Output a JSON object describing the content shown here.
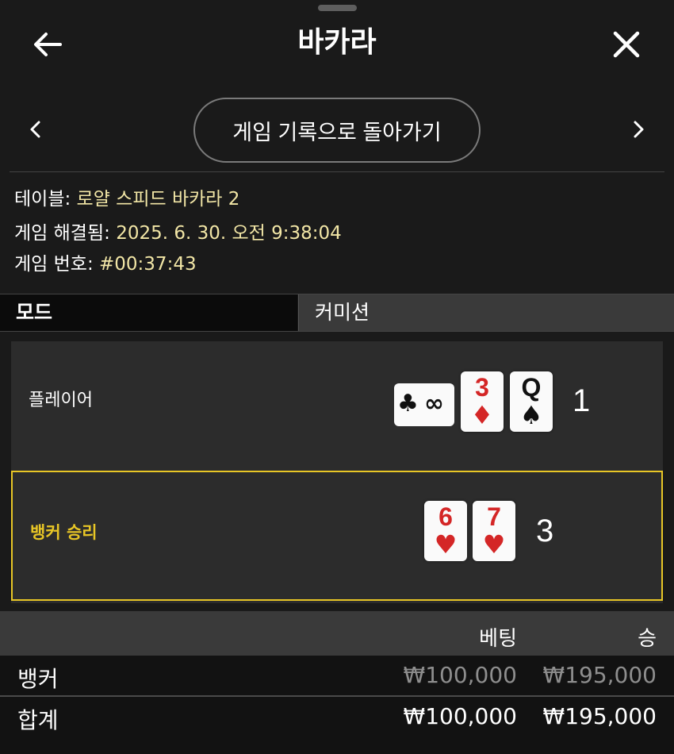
{
  "header": {
    "title": "바카라"
  },
  "nav": {
    "history_button": "게임 기록으로 돌아가기"
  },
  "info": {
    "table_label": "테이블:",
    "table_value": "로얄 스피드 바카라 2",
    "resolved_label": "게임 해결됨:",
    "resolved_value": "2025. 6. 30. 오전 9:38:04",
    "number_label": "게임 번호:",
    "number_value": "#00:37:43"
  },
  "tabs": {
    "mode": "모드",
    "commission": "커미션"
  },
  "result": {
    "player": {
      "label": "플레이어",
      "score": "1",
      "cards": [
        {
          "rank": "∞",
          "suit": "♣",
          "color": "#111111",
          "sideways": true
        },
        {
          "rank": "3",
          "suit": "♦",
          "color": "#d42626"
        },
        {
          "rank": "Q",
          "suit": "♠",
          "color": "#111111"
        }
      ]
    },
    "banker": {
      "label": "뱅커 승리",
      "score": "3",
      "cards": [
        {
          "rank": "6",
          "suit": "♥",
          "color": "#d42626"
        },
        {
          "rank": "7",
          "suit": "♥",
          "color": "#d42626"
        }
      ]
    }
  },
  "bets": {
    "headers": {
      "bet": "베팅",
      "win": "승"
    },
    "rows": [
      {
        "label": "뱅커",
        "bet": "₩100,000",
        "win": "₩195,000"
      }
    ],
    "total": {
      "label": "합계",
      "bet": "₩100,000",
      "win": "₩195,000"
    }
  },
  "colors": {
    "accent": "#e8c626",
    "info_value": "#f2e6a6"
  }
}
